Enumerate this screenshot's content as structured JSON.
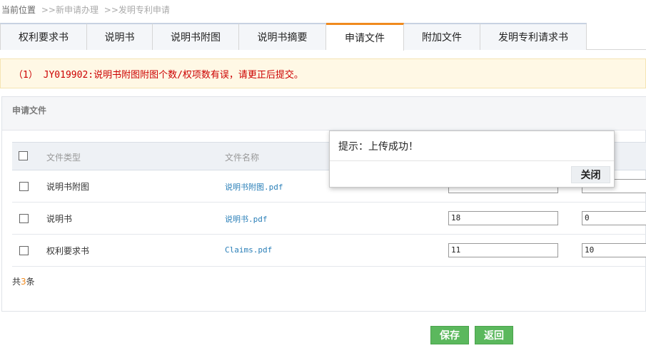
{
  "breadcrumb": {
    "items": [
      "当前位置",
      ">>新申请办理",
      ">>发明专利申请"
    ]
  },
  "tabs": [
    {
      "label": "权利要求书",
      "active": false
    },
    {
      "label": "说明书",
      "active": false
    },
    {
      "label": "说明书附图",
      "active": false
    },
    {
      "label": "说明书摘要",
      "active": false
    },
    {
      "label": "申请文件",
      "active": true
    },
    {
      "label": "附加文件",
      "active": false
    },
    {
      "label": "发明专利请求书",
      "active": false
    }
  ],
  "alert": {
    "text": "（1） JY019902:说明书附图附图个数/权项数有误，请更正后提交。"
  },
  "panel": {
    "title": "申请文件",
    "columns": [
      "文件类型",
      "文件名称"
    ],
    "rows": [
      {
        "type": "说明书附图",
        "name": "说明书附图.pdf",
        "value1": "",
        "value2": ""
      },
      {
        "type": "说明书",
        "name": "说明书.pdf",
        "value1": "18",
        "value2": "0"
      },
      {
        "type": "权利要求书",
        "name": "Claims.pdf",
        "value1": "11",
        "value2": "10"
      }
    ],
    "total_prefix": "共",
    "total_count": "3",
    "total_suffix": "条"
  },
  "actions": {
    "save_label": "保存",
    "back_label": "返回"
  },
  "dialog": {
    "message": "提示：上传成功！",
    "close_label": "关闭"
  },
  "colors": {
    "accent_tab": "#f08a1e",
    "alert_text": "#cc0000",
    "link": "#2a7fb8",
    "button_green": "#5bb85d"
  }
}
